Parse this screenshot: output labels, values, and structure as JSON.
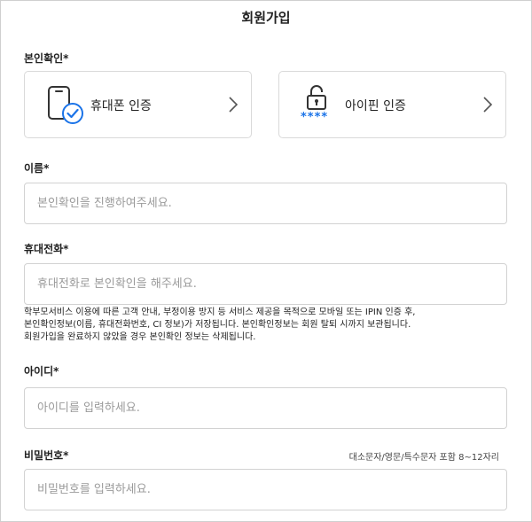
{
  "page": {
    "title": "회원가입"
  },
  "identity": {
    "label": "본인확인*",
    "phone_card": {
      "label": "휴대폰 인증"
    },
    "ipin_card": {
      "label": "아이핀 인증",
      "stars": "****"
    }
  },
  "name": {
    "label": "이름*",
    "placeholder": "본인확인을 진행하여주세요."
  },
  "phone": {
    "label": "휴대전화*",
    "placeholder": "휴대전화로 본인확인을 해주세요.",
    "notice_lines": [
      "학부모서비스 이용에 따른 고객 안내, 부정이용 방지 등 서비스 제공을 목적으로 모바일 또는 IPIN 인증 후,",
      "본인확인정보(이름, 휴대전화번호, CI 정보)가 저장됩니다. 본인확인정보는 회원 탈퇴 시까지 보관됩니다.",
      "회원가입을 완료하지 않았을 경우 본인확인 정보는 삭제됩니다."
    ]
  },
  "userid": {
    "label": "아이디*",
    "placeholder": "아이디를 입력하세요."
  },
  "password": {
    "label": "비밀번호*",
    "hint": "대소문자/영문/특수문자 포함 8~12자리",
    "placeholder": "비밀번호를 입력하세요."
  },
  "colors": {
    "accent": "#1a73e8",
    "border": "#d2d2d2",
    "text": "#222222"
  },
  "icons": {
    "phone": "phone-check-icon",
    "ipin": "padlock-icon",
    "chevron": "chevron-right-icon"
  }
}
